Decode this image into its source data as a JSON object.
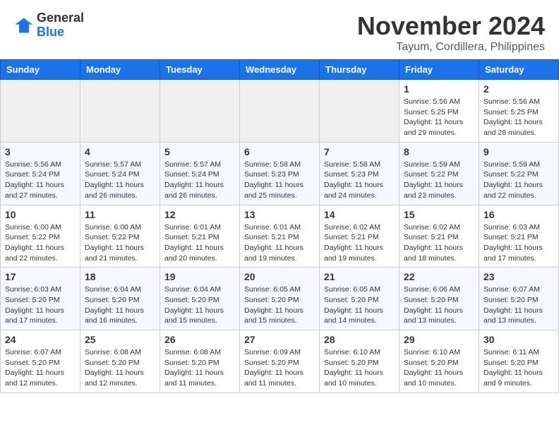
{
  "header": {
    "logo_text_general": "General",
    "logo_text_blue": "Blue",
    "month_title": "November 2024",
    "location": "Tayum, Cordillera, Philippines"
  },
  "columns": [
    "Sunday",
    "Monday",
    "Tuesday",
    "Wednesday",
    "Thursday",
    "Friday",
    "Saturday"
  ],
  "days": {
    "d1": {
      "num": "1",
      "info": "Sunrise: 5:56 AM\nSunset: 5:25 PM\nDaylight: 11 hours\nand 29 minutes."
    },
    "d2": {
      "num": "2",
      "info": "Sunrise: 5:56 AM\nSunset: 5:25 PM\nDaylight: 11 hours\nand 28 minutes."
    },
    "d3": {
      "num": "3",
      "info": "Sunrise: 5:56 AM\nSunset: 5:24 PM\nDaylight: 11 hours\nand 27 minutes."
    },
    "d4": {
      "num": "4",
      "info": "Sunrise: 5:57 AM\nSunset: 5:24 PM\nDaylight: 11 hours\nand 26 minutes."
    },
    "d5": {
      "num": "5",
      "info": "Sunrise: 5:57 AM\nSunset: 5:24 PM\nDaylight: 11 hours\nand 26 minutes."
    },
    "d6": {
      "num": "6",
      "info": "Sunrise: 5:58 AM\nSunset: 5:23 PM\nDaylight: 11 hours\nand 25 minutes."
    },
    "d7": {
      "num": "7",
      "info": "Sunrise: 5:58 AM\nSunset: 5:23 PM\nDaylight: 11 hours\nand 24 minutes."
    },
    "d8": {
      "num": "8",
      "info": "Sunrise: 5:59 AM\nSunset: 5:22 PM\nDaylight: 11 hours\nand 23 minutes."
    },
    "d9": {
      "num": "9",
      "info": "Sunrise: 5:59 AM\nSunset: 5:22 PM\nDaylight: 11 hours\nand 22 minutes."
    },
    "d10": {
      "num": "10",
      "info": "Sunrise: 6:00 AM\nSunset: 5:22 PM\nDaylight: 11 hours\nand 22 minutes."
    },
    "d11": {
      "num": "11",
      "info": "Sunrise: 6:00 AM\nSunset: 5:22 PM\nDaylight: 11 hours\nand 21 minutes."
    },
    "d12": {
      "num": "12",
      "info": "Sunrise: 6:01 AM\nSunset: 5:21 PM\nDaylight: 11 hours\nand 20 minutes."
    },
    "d13": {
      "num": "13",
      "info": "Sunrise: 6:01 AM\nSunset: 5:21 PM\nDaylight: 11 hours\nand 19 minutes."
    },
    "d14": {
      "num": "14",
      "info": "Sunrise: 6:02 AM\nSunset: 5:21 PM\nDaylight: 11 hours\nand 19 minutes."
    },
    "d15": {
      "num": "15",
      "info": "Sunrise: 6:02 AM\nSunset: 5:21 PM\nDaylight: 11 hours\nand 18 minutes."
    },
    "d16": {
      "num": "16",
      "info": "Sunrise: 6:03 AM\nSunset: 5:21 PM\nDaylight: 11 hours\nand 17 minutes."
    },
    "d17": {
      "num": "17",
      "info": "Sunrise: 6:03 AM\nSunset: 5:20 PM\nDaylight: 11 hours\nand 17 minutes."
    },
    "d18": {
      "num": "18",
      "info": "Sunrise: 6:04 AM\nSunset: 5:20 PM\nDaylight: 11 hours\nand 16 minutes."
    },
    "d19": {
      "num": "19",
      "info": "Sunrise: 6:04 AM\nSunset: 5:20 PM\nDaylight: 11 hours\nand 15 minutes."
    },
    "d20": {
      "num": "20",
      "info": "Sunrise: 6:05 AM\nSunset: 5:20 PM\nDaylight: 11 hours\nand 15 minutes."
    },
    "d21": {
      "num": "21",
      "info": "Sunrise: 6:05 AM\nSunset: 5:20 PM\nDaylight: 11 hours\nand 14 minutes."
    },
    "d22": {
      "num": "22",
      "info": "Sunrise: 6:06 AM\nSunset: 5:20 PM\nDaylight: 11 hours\nand 13 minutes."
    },
    "d23": {
      "num": "23",
      "info": "Sunrise: 6:07 AM\nSunset: 5:20 PM\nDaylight: 11 hours\nand 13 minutes."
    },
    "d24": {
      "num": "24",
      "info": "Sunrise: 6:07 AM\nSunset: 5:20 PM\nDaylight: 11 hours\nand 12 minutes."
    },
    "d25": {
      "num": "25",
      "info": "Sunrise: 6:08 AM\nSunset: 5:20 PM\nDaylight: 11 hours\nand 12 minutes."
    },
    "d26": {
      "num": "26",
      "info": "Sunrise: 6:08 AM\nSunset: 5:20 PM\nDaylight: 11 hours\nand 11 minutes."
    },
    "d27": {
      "num": "27",
      "info": "Sunrise: 6:09 AM\nSunset: 5:20 PM\nDaylight: 11 hours\nand 11 minutes."
    },
    "d28": {
      "num": "28",
      "info": "Sunrise: 6:10 AM\nSunset: 5:20 PM\nDaylight: 11 hours\nand 10 minutes."
    },
    "d29": {
      "num": "29",
      "info": "Sunrise: 6:10 AM\nSunset: 5:20 PM\nDaylight: 11 hours\nand 10 minutes."
    },
    "d30": {
      "num": "30",
      "info": "Sunrise: 6:11 AM\nSunset: 5:20 PM\nDaylight: 11 hours\nand 9 minutes."
    }
  }
}
